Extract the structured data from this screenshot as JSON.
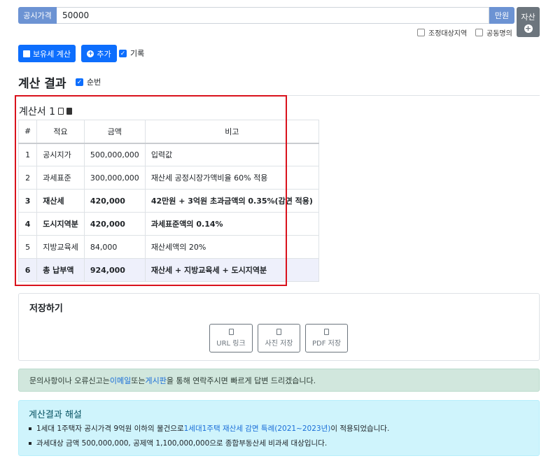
{
  "input": {
    "label": "공시가격",
    "value": "50000",
    "unit": "만원"
  },
  "asset_button": {
    "label": "자산",
    "icon": "plus-circle-icon"
  },
  "options": {
    "adjust_area": "조정대상지역",
    "joint_name": "공동명의"
  },
  "buttons": {
    "calc": "보유세 계산",
    "add": "추가",
    "record": "기록"
  },
  "results": {
    "title": "계산 결과",
    "order_label": "순번"
  },
  "calc_sheet": {
    "title": "계산서 1",
    "headers": [
      "#",
      "적요",
      "금액",
      "비고"
    ],
    "rows": [
      {
        "n": "1",
        "item": "공시지가",
        "amount": "500,000,000",
        "note": "입력값"
      },
      {
        "n": "2",
        "item": "과세표준",
        "amount": "300,000,000",
        "note": "재산세 공정시장가액비율 60% 적용"
      },
      {
        "n": "3",
        "item": "재산세",
        "amount": "420,000",
        "note": "42만원 + 3억원 초과금액의 0.35%(감면 적용)"
      },
      {
        "n": "4",
        "item": "도시지역분",
        "amount": "420,000",
        "note": "과세표준액의 0.14%"
      },
      {
        "n": "5",
        "item": "지방교육세",
        "amount": "84,000",
        "note": "재산세액의 20%"
      },
      {
        "n": "6",
        "item": "총 납부액",
        "amount": "924,000",
        "note": "재산세 + 지방교육세 + 도시지역분"
      }
    ]
  },
  "save": {
    "title": "저장하기",
    "url": "URL 링크",
    "photo": "사진 저장",
    "pdf": "PDF 저장"
  },
  "alert": {
    "pre": "문의사항이나 오류신고는 ",
    "email": "이메일",
    "mid": " 또는 ",
    "board": "게시판",
    "post": "을 통해 연락주시면 빠르게 답변 드리겠습니다."
  },
  "explanation": {
    "title": "계산결과 해설",
    "line1_pre": "1세대 1주택자 공시가격 9억원 이하의 물건으로 ",
    "line1_link": "1세대1주택 재산세 감면 특례(2021~2023년)",
    "line1_post": "이 적용되었습니다.",
    "line2": "과세대상 금액 500,000,000, 공제액 1,100,000,000으로 종합부동산세 비과세 대상입니다."
  }
}
